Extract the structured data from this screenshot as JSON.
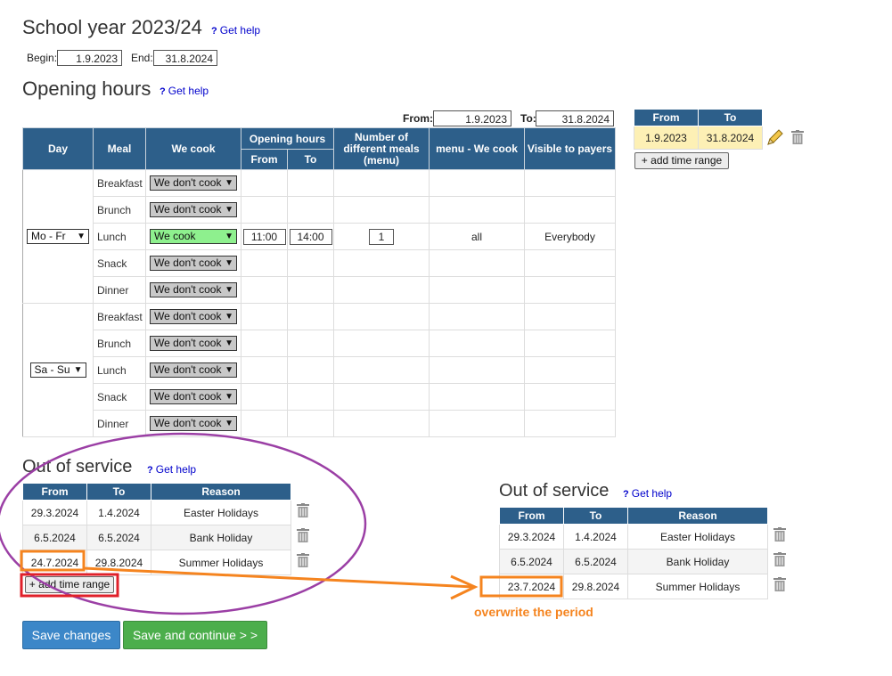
{
  "school_year": {
    "title": "School year 2023/24",
    "help": "Get help",
    "begin_label": "Begin:",
    "begin_value": "1.9.2023",
    "end_label": "End:",
    "end_value": "31.8.2024"
  },
  "opening": {
    "title": "Opening hours",
    "help": "Get help",
    "from_label": "From:",
    "from_value": "1.9.2023",
    "to_label": "To:",
    "to_value": "31.8.2024"
  },
  "table": {
    "headers": {
      "day": "Day",
      "meal": "Meal",
      "we_cook": "We cook",
      "opening_hours": "Opening hours",
      "from": "From",
      "to": "To",
      "num_meals": "Number of different meals (menu)",
      "menu": "menu - We cook",
      "visible": "Visible to payers"
    },
    "groups": [
      {
        "day": "Mo - Fr",
        "rows": [
          {
            "meal": "Breakfast",
            "cook": "We don't cook"
          },
          {
            "meal": "Brunch",
            "cook": "We don't cook"
          },
          {
            "meal": "Lunch",
            "cook": "We cook",
            "from": "11:00",
            "to": "14:00",
            "num": "1",
            "menu": "all",
            "visible": "Everybody"
          },
          {
            "meal": "Snack",
            "cook": "We don't cook"
          },
          {
            "meal": "Dinner",
            "cook": "We don't cook"
          }
        ]
      },
      {
        "day": "Sa - Su",
        "rows": [
          {
            "meal": "Breakfast",
            "cook": "We don't cook"
          },
          {
            "meal": "Brunch",
            "cook": "We don't cook"
          },
          {
            "meal": "Lunch",
            "cook": "We don't cook"
          },
          {
            "meal": "Snack",
            "cook": "We don't cook"
          },
          {
            "meal": "Dinner",
            "cook": "We don't cook"
          }
        ]
      }
    ]
  },
  "ranges": {
    "headers": {
      "from": "From",
      "to": "To"
    },
    "rows": [
      {
        "from": "1.9.2023",
        "to": "31.8.2024"
      }
    ],
    "add": "+ add time range"
  },
  "oos_left": {
    "title": "Out of service",
    "help": "Get help",
    "headers": {
      "from": "From",
      "to": "To",
      "reason": "Reason"
    },
    "rows": [
      {
        "from": "29.3.2024",
        "to": "1.4.2024",
        "reason": "Easter Holidays"
      },
      {
        "from": "6.5.2024",
        "to": "6.5.2024",
        "reason": "Bank Holiday"
      },
      {
        "from": "24.7.2024",
        "to": "29.8.2024",
        "reason": "Summer Holidays"
      }
    ],
    "add": "+ add time range"
  },
  "oos_right": {
    "title": "Out of service",
    "help": "Get help",
    "headers": {
      "from": "From",
      "to": "To",
      "reason": "Reason"
    },
    "rows": [
      {
        "from": "29.3.2024",
        "to": "1.4.2024",
        "reason": "Easter Holidays"
      },
      {
        "from": "6.5.2024",
        "to": "6.5.2024",
        "reason": "Bank Holiday"
      },
      {
        "from": "23.7.2024",
        "to": "29.8.2024",
        "reason": "Summer Holidays"
      }
    ]
  },
  "annotation": {
    "note": "overwrite the period"
  },
  "buttons": {
    "save": "Save changes",
    "save_continue": "Save and continue > >"
  },
  "colors": {
    "header_blue": "#2d5f8a",
    "cook_green": "#8ef08e",
    "annotation_orange": "#f5841f",
    "annotation_purple": "#9b3fa5",
    "annotation_red": "#e0202a",
    "save_blue": "#3c87c8",
    "continue_green": "#4cae4c"
  }
}
